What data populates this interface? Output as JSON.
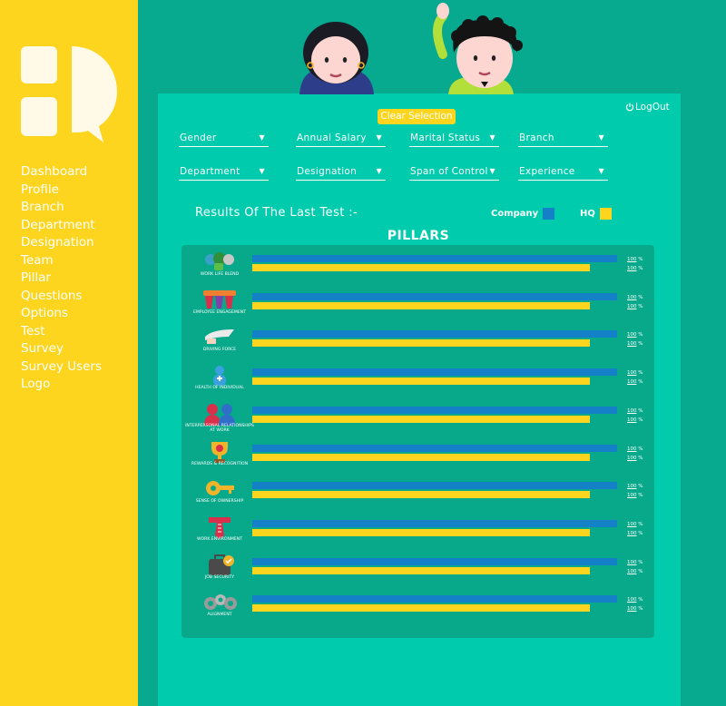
{
  "colors": {
    "sidebar": "#fdd51f",
    "background": "#07a98f",
    "panel": "#00ccad",
    "company": "#1480c8",
    "hq": "#fdd51f"
  },
  "sidebar": {
    "items": [
      {
        "label": "Dashboard"
      },
      {
        "label": "Profile"
      },
      {
        "label": "Branch"
      },
      {
        "label": "Department"
      },
      {
        "label": "Designation"
      },
      {
        "label": "Team"
      },
      {
        "label": "Pillar"
      },
      {
        "label": "Questions"
      },
      {
        "label": "Options"
      },
      {
        "label": "Test"
      },
      {
        "label": "Survey"
      },
      {
        "label": "Survey Users"
      },
      {
        "label": "Logo"
      }
    ]
  },
  "header": {
    "clear_selection": "Clear Selection",
    "logout": "LogOut"
  },
  "filters": [
    {
      "label": "Gender"
    },
    {
      "label": "Annual Salary"
    },
    {
      "label": "Marital Status"
    },
    {
      "label": "Branch"
    },
    {
      "label": "Department"
    },
    {
      "label": "Designation"
    },
    {
      "label": "Span of Control"
    },
    {
      "label": "Experience"
    }
  ],
  "results": {
    "title": "Results Of The Last Test :-",
    "legend": {
      "company": "Company",
      "hq": "HQ"
    },
    "pillars_title": "PILLARS"
  },
  "percent_sign": "%",
  "chart_data": {
    "type": "bar",
    "orientation": "horizontal",
    "categories": [
      "WORK LIFE BLEND",
      "EMPLOYEE ENGAGEMENT",
      "DRIVING FORCE",
      "HEALTH OF INDIVIDUAL",
      "INTERPERSONAL RELATIONSHIPS AT WORK",
      "REWARDS & RECOGNITION",
      "SENSE OF OWNERSHIP",
      "WORK ENVIRONMENT",
      "JOB SECURITY",
      "ALIGNMENT"
    ],
    "series": [
      {
        "name": "Company",
        "values": [
          100,
          100,
          100,
          100,
          100,
          100,
          100,
          100,
          100,
          100
        ],
        "labels": [
          "100",
          "100",
          "100",
          "100",
          "100",
          "100",
          "100",
          "100",
          "100",
          "100"
        ]
      },
      {
        "name": "HQ",
        "values": [
          100,
          100,
          100,
          100,
          100,
          100,
          100,
          100,
          100,
          100
        ],
        "labels": [
          "100",
          "100",
          "100",
          "100",
          "100",
          "100",
          "100",
          "100",
          "100",
          "100"
        ]
      }
    ],
    "hq_bar_fill_fraction": [
      0.925,
      0.925,
      0.925,
      0.925,
      0.925,
      0.925,
      0.925,
      0.925,
      0.925,
      0.925
    ],
    "icons": [
      "work-life-blend-icon",
      "employee-engagement-icon",
      "driving-force-icon",
      "health-of-individual-icon",
      "interpersonal-relationships-icon",
      "rewards-recognition-icon",
      "sense-of-ownership-icon",
      "work-environment-icon",
      "job-security-icon",
      "alignment-icon"
    ]
  }
}
